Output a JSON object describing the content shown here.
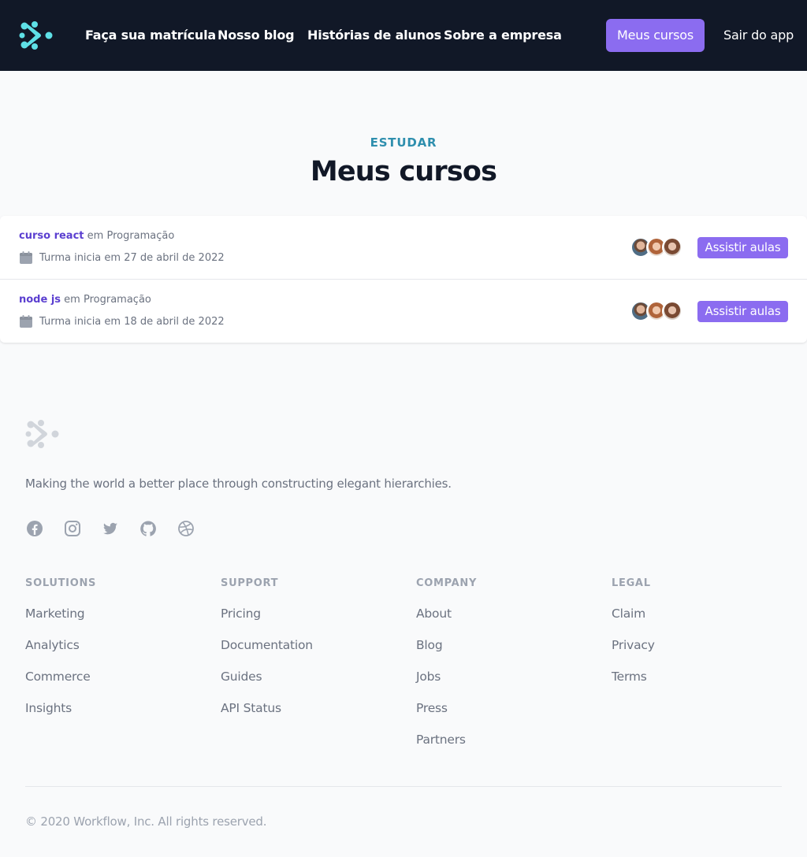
{
  "nav": {
    "links": [
      "Faça sua matrícula",
      "Nosso blog",
      "Histórias de alunos",
      "Sobre a empresa"
    ],
    "cta": "Meus cursos",
    "logout": "Sair do app"
  },
  "heading": {
    "eyebrow": "ESTUDAR",
    "title": "Meus cursos"
  },
  "courses": [
    {
      "name": "curso react",
      "category_prefix": "em",
      "category": "Programação",
      "start": "Turma inicia em 27 de abril de 2022",
      "button": "Assistir aulas"
    },
    {
      "name": "node js",
      "category_prefix": "em",
      "category": "Programação",
      "start": "Turma inicia em 18 de abril de 2022",
      "button": "Assistir aulas"
    }
  ],
  "footer": {
    "tagline": "Making the world a better place through constructing elegant hierarchies.",
    "social": [
      "facebook-icon",
      "instagram-icon",
      "twitter-icon",
      "github-icon",
      "dribbble-icon"
    ],
    "columns": [
      {
        "heading": "SOLUTIONS",
        "links": [
          "Marketing",
          "Analytics",
          "Commerce",
          "Insights"
        ]
      },
      {
        "heading": "SUPPORT",
        "links": [
          "Pricing",
          "Documentation",
          "Guides",
          "API Status"
        ]
      },
      {
        "heading": "COMPANY",
        "links": [
          "About",
          "Blog",
          "Jobs",
          "Press",
          "Partners"
        ]
      },
      {
        "heading": "LEGAL",
        "links": [
          "Claim",
          "Privacy",
          "Terms"
        ]
      }
    ],
    "copyright": "© 2020 Workflow, Inc. All rights reserved."
  },
  "colors": {
    "header_bg": "#111827",
    "accent": "#8b6cf0",
    "logo": "#5ee0e6",
    "eyebrow": "#2f8fae",
    "course_link": "#5b3fd0"
  }
}
